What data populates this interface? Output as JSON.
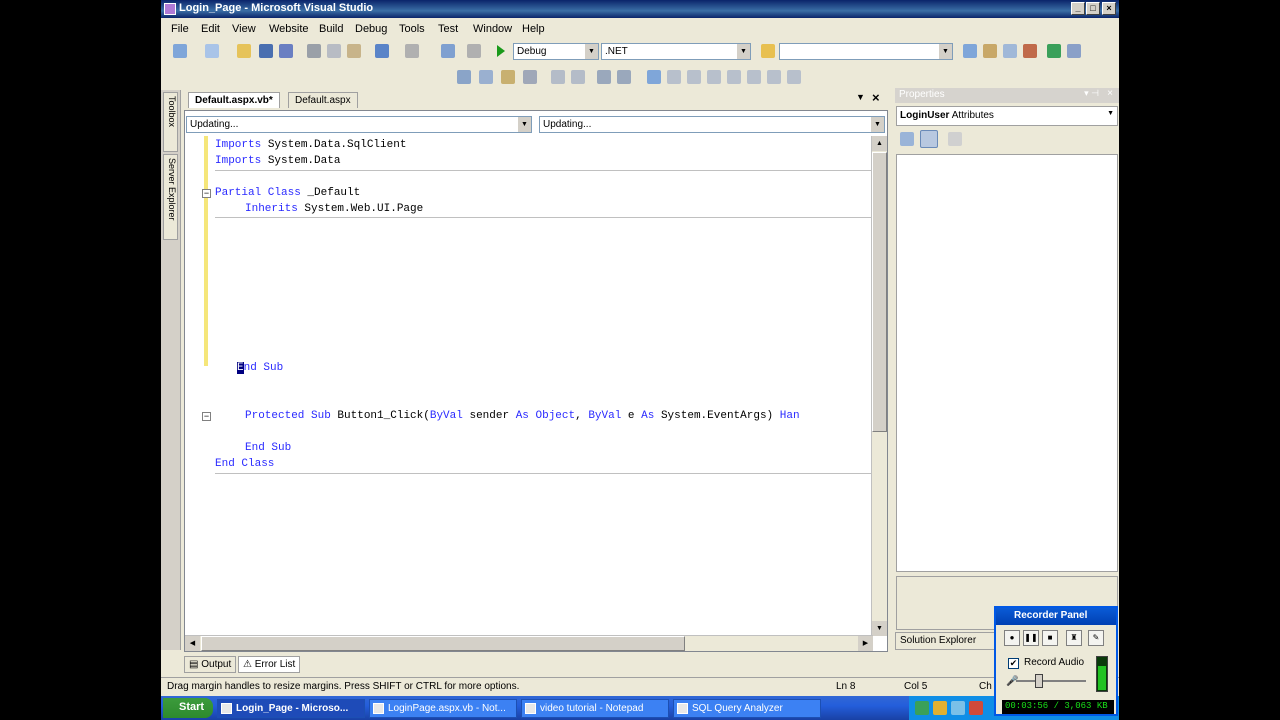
{
  "window": {
    "title": "Login_Page - Microsoft Visual Studio"
  },
  "menu": [
    "File",
    "Edit",
    "View",
    "Website",
    "Build",
    "Debug",
    "Tools",
    "Test",
    "Window",
    "Help"
  ],
  "toolbar": {
    "config": "Debug",
    "platform": ".NET",
    "find_combo": ""
  },
  "side_tabs": [
    "Toolbox",
    "Server Explorer"
  ],
  "editor": {
    "tabs": [
      {
        "label": "Default.aspx.vb*",
        "active": true
      },
      {
        "label": "Default.aspx",
        "active": false
      }
    ],
    "nav_left": "Updating...",
    "nav_right": "Updating..."
  },
  "code": {
    "imports1_kw": "Imports",
    "imports1_rest": " System.Data.SqlClient",
    "imports2_kw": "Imports",
    "imports2_rest": " System.Data",
    "class_kw": "Partial Class",
    "class_name": " _Default",
    "inherits_kw": "Inherits",
    "inherits_rest": " System.Web.UI.Page",
    "endsub1_cursor": "E",
    "endsub1_rest": "nd Sub",
    "protected_kw": "Protected Sub",
    "protected_mid": " Button1_Click(",
    "byval1": "ByVal",
    "sender": " sender ",
    "as1": "As",
    "object": " Object",
    "comma": ", ",
    "byval2": "ByVal",
    "e": " e ",
    "as2": "As",
    "eventargs": " System.EventArgs) ",
    "han": "Han",
    "endsub2": "End Sub",
    "endclass": "End Class"
  },
  "properties": {
    "header": "Properties",
    "object_name": "LoginUser",
    "object_type": "Attributes",
    "solution_tab": "Solution Explorer"
  },
  "bottom_tabs": [
    "Output",
    "Error List"
  ],
  "status": {
    "message": "Drag margin handles to resize margins. Press SHIFT or CTRL for more options.",
    "line": "Ln 8",
    "col": "Col 5",
    "ch": "Ch"
  },
  "taskbar": {
    "start": "Start",
    "tasks": [
      {
        "label": "Login_Page - Microso...",
        "active": true
      },
      {
        "label": "LoginPage.aspx.vb - Not...",
        "active": false
      },
      {
        "label": "video tutorial - Notepad",
        "active": false
      },
      {
        "label": "SQL Query Analyzer",
        "active": false
      }
    ]
  },
  "recorder": {
    "title": "Recorder Panel",
    "record_audio_label": "Record Audio",
    "record_audio_checked": true,
    "timer": "00:03:56 / 3,063 KB",
    "volume_level": 0.3,
    "meter_level": 0.75
  },
  "colors": {
    "keyword": "#2a2aff",
    "titlebar": "#0a246a",
    "chrome": "#ece9d8",
    "taskbar": "#245edb"
  }
}
